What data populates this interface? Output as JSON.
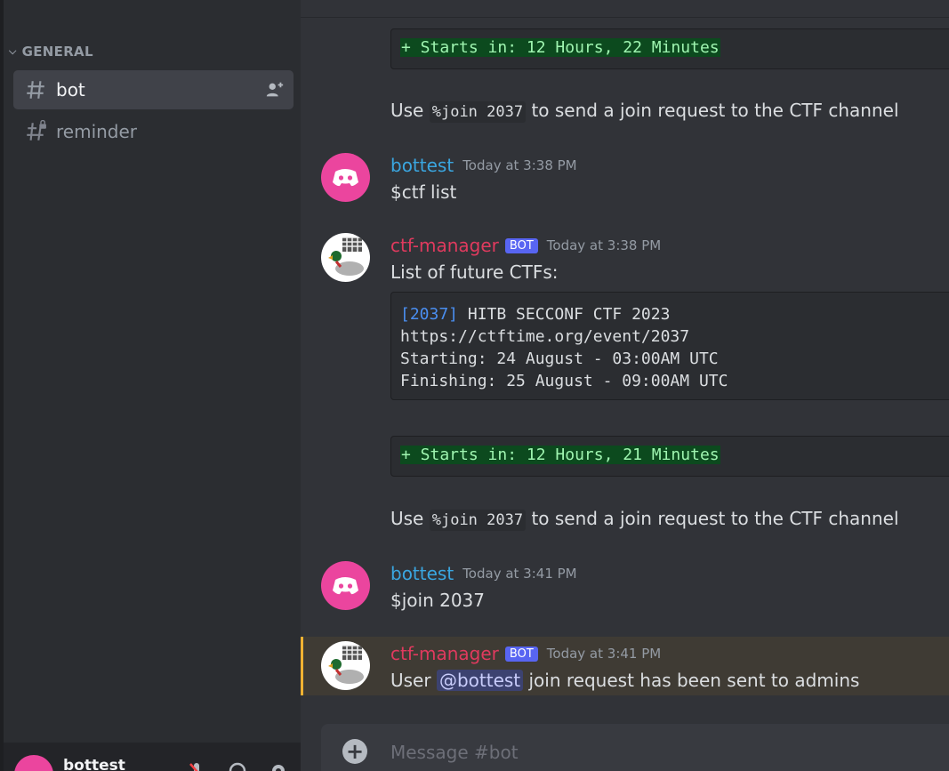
{
  "sidebar": {
    "category": "GENERAL",
    "channels": [
      {
        "name": "bot",
        "active": true,
        "icon": "hash-icon"
      },
      {
        "name": "reminder",
        "active": false,
        "icon": "hash-lock-icon"
      }
    ],
    "user": {
      "name": "bottest"
    }
  },
  "messages": {
    "block1": {
      "diff": "+ Starts in: 12 Hours, 22 Minutes",
      "use_prefix": "Use ",
      "use_code": "%join 2037",
      "use_suffix": " to send a join request to the CTF channel"
    },
    "m1": {
      "author": "bottest",
      "time": "Today at 3:38 PM",
      "text": "$ctf list"
    },
    "m2": {
      "author": "ctf-manager",
      "badge": "BOT",
      "time": "Today at 3:38 PM",
      "text": "List of future CTFs:",
      "code_tag": "[2037]",
      "code_title": " HITB SECCONF CTF 2023",
      "code_url": "https://ctftime.org/event/2037",
      "code_start": "Starting: 24 August - 03:00AM UTC",
      "code_finish": "Finishing: 25 August - 09:00AM UTC",
      "diff": "+ Starts in: 12 Hours, 21 Minutes",
      "use_prefix": "Use ",
      "use_code": "%join 2037",
      "use_suffix": " to send a join request to the CTF channel"
    },
    "m3": {
      "author": "bottest",
      "time": "Today at 3:41 PM",
      "text": "$join 2037"
    },
    "m4": {
      "author": "ctf-manager",
      "badge": "BOT",
      "time": "Today at 3:41 PM",
      "text_prefix": "User ",
      "mention": "@bottest",
      "text_suffix": " join request has been sent to admins"
    }
  },
  "composer": {
    "placeholder": "Message #bot",
    "plus": "+"
  },
  "colors": {
    "accent": "#5865f2",
    "bottest": "#3aa6e0",
    "ctf_manager": "#e03a5e",
    "highlight_border": "#f0b232"
  }
}
